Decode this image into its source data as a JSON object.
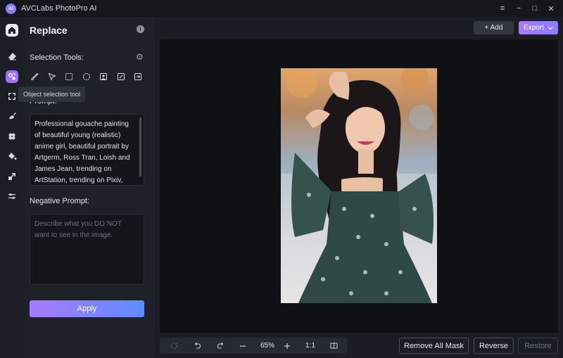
{
  "app": {
    "title": "AVCLabs PhotoPro AI",
    "logo_text": "AI"
  },
  "window_controls": {
    "menu": "≡",
    "minimize": "−",
    "maximize": "□",
    "close": "✕"
  },
  "panel": {
    "title": "Replace",
    "selection_tools_label": "Selection Tools:",
    "tooltip": "Object selection tool",
    "prompt_label": "Prompt:",
    "prompt_text": "Professional gouache painting of beautiful young (realistic) anime girl, beautiful portrait by Artgerm, Ross Tran, Loish and James Jean, trending on ArtStation, trending on Pixiv,",
    "negative_label": "Negative Prompt:",
    "negative_placeholder": "Describe what you DO NOT want to see in the image.",
    "apply_label": "Apply"
  },
  "toolbar": {
    "add_label": "+ Add",
    "export_label": "Export"
  },
  "zoombar": {
    "zoom": "65%",
    "ratio": "1:1"
  },
  "bottom": {
    "remove_all_mask": "Remove All Mask",
    "reverse": "Reverse",
    "restore": "Restore"
  },
  "colors": {
    "accent_start": "#a97bff",
    "accent_end": "#5e8bff",
    "background": "#1a1d23",
    "canvas": "#0f1114"
  }
}
